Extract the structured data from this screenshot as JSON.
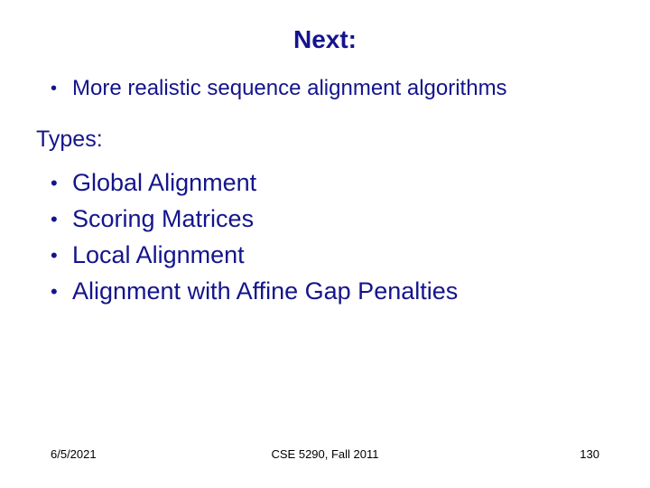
{
  "title": "Next:",
  "intro_bullet": "More realistic sequence alignment algorithms",
  "types_label": "Types:",
  "types": [
    "Global Alignment",
    "Scoring Matrices",
    "Local Alignment",
    "Alignment with Affine Gap Penalties"
  ],
  "footer": {
    "date": "6/5/2021",
    "course": "CSE 5290, Fall 2011",
    "page": "130"
  }
}
